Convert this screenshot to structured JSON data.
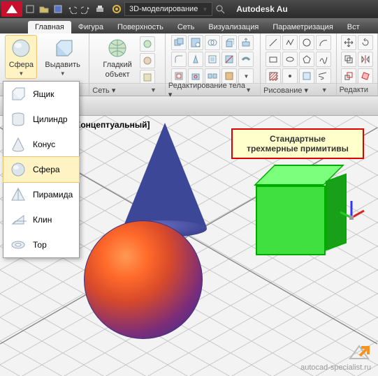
{
  "titlebar": {
    "workspace": "3D-моделирование",
    "app_name": "Autodesk Au"
  },
  "ribbon": {
    "tabs": [
      "Главная",
      "Фигура",
      "Поверхность",
      "Сеть",
      "Визуализация",
      "Параметризация",
      "Вст"
    ],
    "active_tab": 0,
    "panels": {
      "modeling": {
        "label": "не ▾",
        "btn_sphere": "Сфера",
        "btn_extrude": "Выдавить"
      },
      "smooth": {
        "label": "Сеть ▾",
        "btn_smooth_a": "Гладкий",
        "btn_smooth_b": "объект"
      },
      "edit": {
        "label": "Редактирование тела ▾"
      },
      "draw": {
        "label": "Рисование ▾"
      },
      "modify": {
        "label": "Редакти"
      }
    }
  },
  "dropdown": {
    "items": [
      "Ящик",
      "Цилиндр",
      "Конус",
      "Сфера",
      "Пирамида",
      "Клин",
      "Тор"
    ],
    "selected": 3
  },
  "canvas": {
    "view_style_label": "Концептуальный]",
    "callout_line1": "Стандартные",
    "callout_line2": "трехмерные примитивы"
  },
  "watermark": {
    "text": "autocad-specialist.ru"
  }
}
